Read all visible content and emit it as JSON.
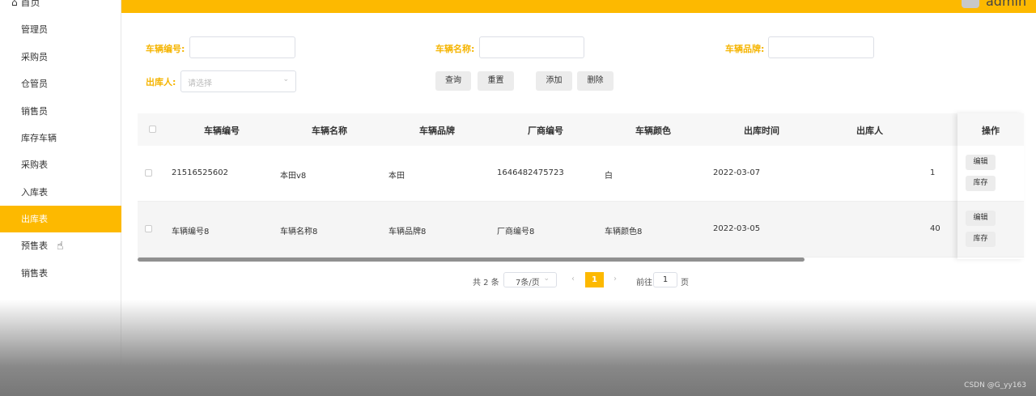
{
  "sidebar": {
    "home": "首页",
    "items": [
      "管理员",
      "采购员",
      "仓管员",
      "销售员",
      "库存车辆",
      "采购表",
      "入库表",
      "出库表",
      "预售表",
      "销售表"
    ],
    "active": "出库表"
  },
  "header": {
    "user": "admin",
    "accent": "#fdb900"
  },
  "search": {
    "vehicle_no_label": "车辆编号:",
    "vehicle_name_label": "车辆名称:",
    "vehicle_brand_label": "车辆品牌:",
    "outbound_person_label": "出库人:",
    "outbound_person_placeholder": "请选择",
    "query": "查询",
    "reset": "重置",
    "add": "添加",
    "delete": "删除"
  },
  "table": {
    "headers": [
      "车辆编号",
      "车辆名称",
      "车辆品牌",
      "厂商编号",
      "车辆颜色",
      "出库时间",
      "出库人",
      "操作"
    ],
    "rows": [
      [
        "21516525602",
        "本田v8",
        "本田",
        "1646482475723",
        "白",
        "2022-03-07",
        "1"
      ],
      [
        "车辆编号8",
        "车辆名称8",
        "车辆品牌8",
        "厂商编号8",
        "车辆颜色8",
        "2022-03-05",
        "40"
      ]
    ],
    "edit": "编辑",
    "stock": "库存"
  },
  "pagination": {
    "total": "共 2 条",
    "page_size": "7条/页",
    "current": "1",
    "goto": "前往",
    "goto_value": "1",
    "page_unit": "页"
  },
  "watermark": "CSDN @G_yy163"
}
